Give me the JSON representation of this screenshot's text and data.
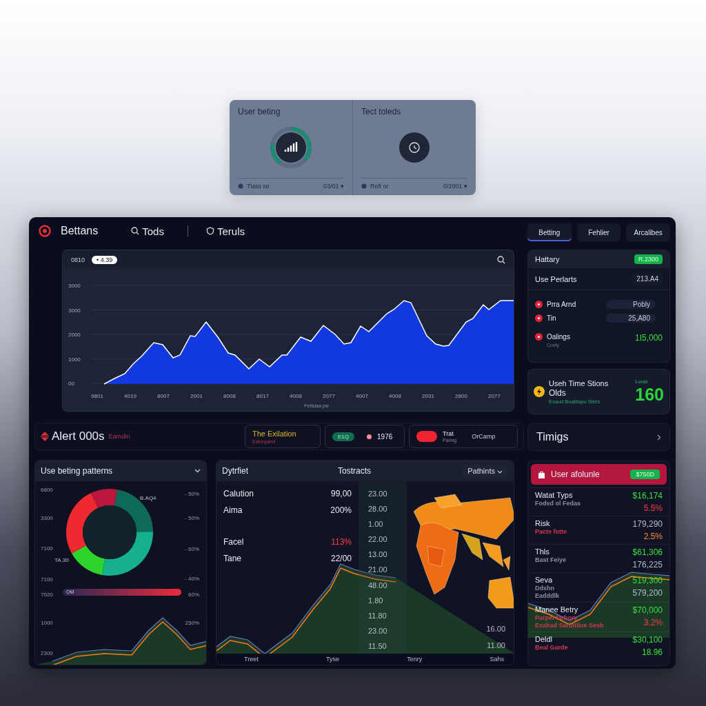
{
  "top_card": {
    "panels": [
      {
        "kind": "gauge",
        "title": "User beting",
        "footer_label": "Ttata xe",
        "footer_value": "03/01 ▾"
      },
      {
        "kind": "plain",
        "title": "Tect toleds",
        "footer_label": "Relt or",
        "footer_value": "0/2001 ▾"
      }
    ]
  },
  "header": {
    "brand": "Bettans",
    "nav": [
      {
        "label": "Tods"
      },
      {
        "label": "Teruls"
      }
    ]
  },
  "main_chart": {
    "label": "0810",
    "badge": "• 4.39",
    "y_axis": [
      "3000",
      "3000",
      "2000",
      "1000",
      "00"
    ],
    "x_axis": [
      "9801",
      "4019",
      "8007",
      "2001",
      "8008",
      "8017",
      "4008",
      "2077",
      "4007",
      "4008",
      "2031",
      "2800",
      "2077"
    ],
    "axis_title": "Fetlsiaa pw"
  },
  "alert_bar": {
    "title": "Alert 000s",
    "subtitle": "Earndin",
    "items": [
      {
        "kind": "text",
        "title": "The Exilation",
        "subtitle": "Ealnnyand"
      },
      {
        "kind": "pill",
        "pill": "E1Q",
        "value": "1976"
      },
      {
        "kind": "toggle",
        "on": true,
        "title": "Trat",
        "subtitle": "Paring",
        "value": "OrCamp"
      }
    ]
  },
  "patterns_panel": {
    "title": "Use beting patterns",
    "left_axis": [
      "6800",
      "3300",
      "7100",
      "7100",
      "7020",
      "1000",
      "2300"
    ],
    "right_axis": [
      "- 50%",
      "- 50%",
      "- 60%",
      "- 40%",
      "60%",
      "250%"
    ],
    "donut_labels": [
      "B.AQ4",
      "TA.30"
    ],
    "bar_label": "OM"
  },
  "transactions_panel": {
    "title": "Dytrfiet",
    "subtitle": "Tostracts",
    "dropdown": "Pathints",
    "rows": [
      {
        "label": "Calution",
        "value": "99,00",
        "alert": false
      },
      {
        "label": "Aima",
        "value": "200%",
        "alert": false
      },
      {
        "label": "Facel",
        "value": "113%",
        "alert": true
      },
      {
        "label": "Tane",
        "value": "22/00",
        "alert": false
      }
    ],
    "column_3": [
      "23.00",
      "28.00",
      "1.00",
      "22.00",
      "13.00",
      "21.00",
      "48.00",
      "1.80",
      "11.80",
      "23.00",
      "11.50"
    ],
    "right_values": [
      "16.00",
      "11.00"
    ],
    "footer": [
      "Treet",
      "Tyse",
      "Tenry",
      "Sahs"
    ]
  },
  "side_tabs": [
    {
      "label": "Betting",
      "selected": true
    },
    {
      "label": "Fehlier",
      "selected": false
    },
    {
      "label": "Arcalibes",
      "selected": false
    }
  ],
  "summary_card": {
    "title": "Hattary",
    "badge": "R.2300",
    "subtitle": "Use Perlarts",
    "subtitle_value": "213.A4",
    "items": [
      {
        "kind": "pill",
        "label": "Prra Arnd",
        "value": "Pobly"
      },
      {
        "kind": "pill",
        "label": "Tin",
        "value": "25,A80"
      },
      {
        "kind": "plain",
        "label": "Oalings",
        "note": "Covty",
        "value": "1I5,000"
      }
    ]
  },
  "time_card": {
    "title": "Useh Time Stions",
    "subtitle": "Olds",
    "note": "Exaud Bualitapu Sters",
    "caption": "Lwak",
    "value": "160"
  },
  "timings": {
    "label": "Timigs"
  },
  "user_card": {
    "title": "User afolunle",
    "badge": "$750D",
    "rows": [
      {
        "label": "Watat Typs",
        "notes": [
          {
            "text": "Fodsd ol Fedas",
            "color": "#8a90a2"
          }
        ],
        "values": [
          {
            "text": "$16,174",
            "color": "#37e03a"
          },
          {
            "text": "5.5%",
            "color": "#ff3b4a"
          }
        ]
      },
      {
        "label": "Risk",
        "notes": [
          {
            "text": "Pacte fotte",
            "color": "#d0384e"
          }
        ],
        "values": [
          {
            "text": "179,290",
            "color": "#b4bccb"
          },
          {
            "text": "2.5%",
            "color": "#ff8a2a"
          }
        ]
      },
      {
        "label": "Thls",
        "notes": [
          {
            "text": "Bast Feiye",
            "color": "#8a90a2"
          }
        ],
        "values": [
          {
            "text": "$61,306",
            "color": "#37e03a"
          },
          {
            "text": "176,225",
            "color": "#b4bccb"
          }
        ]
      },
      {
        "label": "Seva",
        "notes": [
          {
            "text": "Ddshn",
            "color": "#8a90a2"
          },
          {
            "text": "Eadddlk",
            "color": "#8a90a2"
          }
        ],
        "values": [
          {
            "text": "519,300",
            "color": "#37e03a"
          },
          {
            "text": "579,200",
            "color": "#b4bccb"
          }
        ]
      },
      {
        "label": "Manee Betry",
        "notes": [
          {
            "text": "Parpet farbory",
            "color": "#d0384e"
          },
          {
            "text": "Exabad Sarbitilue Sesb",
            "color": "#d0384e"
          }
        ],
        "values": [
          {
            "text": "$70,000",
            "color": "#37e03a"
          },
          {
            "text": "3.2%",
            "color": "#ff3b4a"
          }
        ]
      },
      {
        "label": "Deldl",
        "notes": [
          {
            "text": "Beal Garde",
            "color": "#d0384e"
          }
        ],
        "values": [
          {
            "text": "$30,100",
            "color": "#37e03a"
          },
          {
            "text": "18.96",
            "color": "#37e03a"
          }
        ]
      }
    ]
  }
}
